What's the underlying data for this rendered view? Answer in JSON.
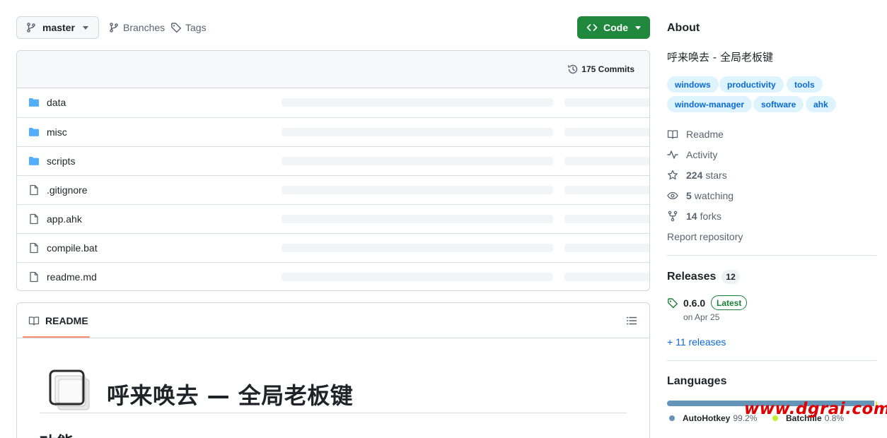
{
  "toolbar": {
    "branch": "master",
    "branches_label": "Branches",
    "tags_label": "Tags",
    "code_label": "Code"
  },
  "files_header": {
    "commits_label": "175 Commits"
  },
  "files": [
    {
      "name": "data",
      "type": "folder"
    },
    {
      "name": "misc",
      "type": "folder"
    },
    {
      "name": "scripts",
      "type": "folder"
    },
    {
      "name": ".gitignore",
      "type": "file"
    },
    {
      "name": "app.ahk",
      "type": "file"
    },
    {
      "name": "compile.bat",
      "type": "file"
    },
    {
      "name": "readme.md",
      "type": "file"
    }
  ],
  "readme": {
    "tab_label": "README",
    "title": "呼来唤去 — 全局老板键",
    "subheading": "功能"
  },
  "about": {
    "heading": "About",
    "description": "呼来唤去 - 全局老板键",
    "topics": [
      "windows",
      "productivity",
      "tools",
      "window-manager",
      "software",
      "ahk"
    ],
    "readme_label": "Readme",
    "activity_label": "Activity",
    "stars_count": "224",
    "stars_label": "stars",
    "watching_count": "5",
    "watching_label": "watching",
    "forks_count": "14",
    "forks_label": "forks",
    "report_label": "Report repository"
  },
  "releases": {
    "heading": "Releases",
    "count": "12",
    "version": "0.6.0",
    "latest_label": "Latest",
    "date": "on Apr 25",
    "more_label": "+ 11 releases"
  },
  "languages": {
    "heading": "Languages",
    "items": [
      {
        "name": "AutoHotkey",
        "percent": "99.2%",
        "value": 99.2,
        "color": "#6594b9"
      },
      {
        "name": "Batchfile",
        "percent": "0.8%",
        "value": 0.8,
        "color": "#c1f12e"
      }
    ]
  },
  "watermark": "www.dgrai.com",
  "colors": {
    "accent": "#0969da",
    "code_button": "#1f883d",
    "folder_icon": "#54aeff"
  }
}
